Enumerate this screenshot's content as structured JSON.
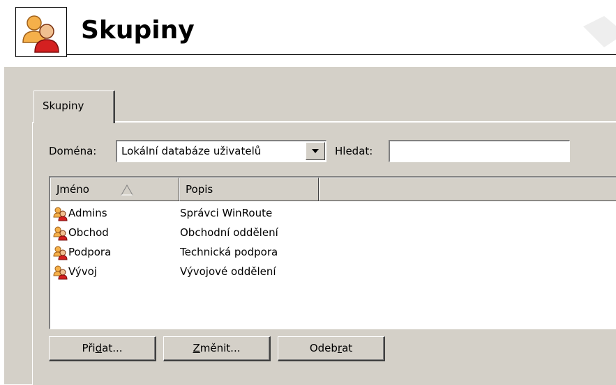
{
  "header": {
    "title": "Skupiny",
    "icon": "users-group-icon"
  },
  "tabs": [
    {
      "label": "Skupiny",
      "active": true
    }
  ],
  "filter": {
    "domain_label": "Doména:",
    "domain_value": "Lokální databáze uživatelů",
    "search_label": "Hledat:",
    "search_value": ""
  },
  "table": {
    "columns": [
      "Jméno",
      "Popis"
    ],
    "sort_column": "Jméno",
    "rows": [
      {
        "name": "Admins",
        "description": "Správci WinRoute",
        "icon": "group-icon"
      },
      {
        "name": "Obchod",
        "description": "Obchodní oddělení",
        "icon": "group-icon"
      },
      {
        "name": "Podpora",
        "description": "Technická podpora",
        "icon": "group-icon"
      },
      {
        "name": "Vývoj",
        "description": "Vývojové oddělení",
        "icon": "group-icon"
      }
    ]
  },
  "buttons": {
    "add": {
      "before": "Při",
      "mnemonic": "d",
      "after": "at..."
    },
    "edit": {
      "before": "",
      "mnemonic": "Z",
      "after": "měnit..."
    },
    "remove": {
      "before": "Odeb",
      "mnemonic": "r",
      "after": "at"
    }
  },
  "colors": {
    "panel": "#d4d0c8",
    "window": "#ffffff",
    "group_icon_red": "#d42020",
    "group_icon_orange": "#f0a030"
  }
}
